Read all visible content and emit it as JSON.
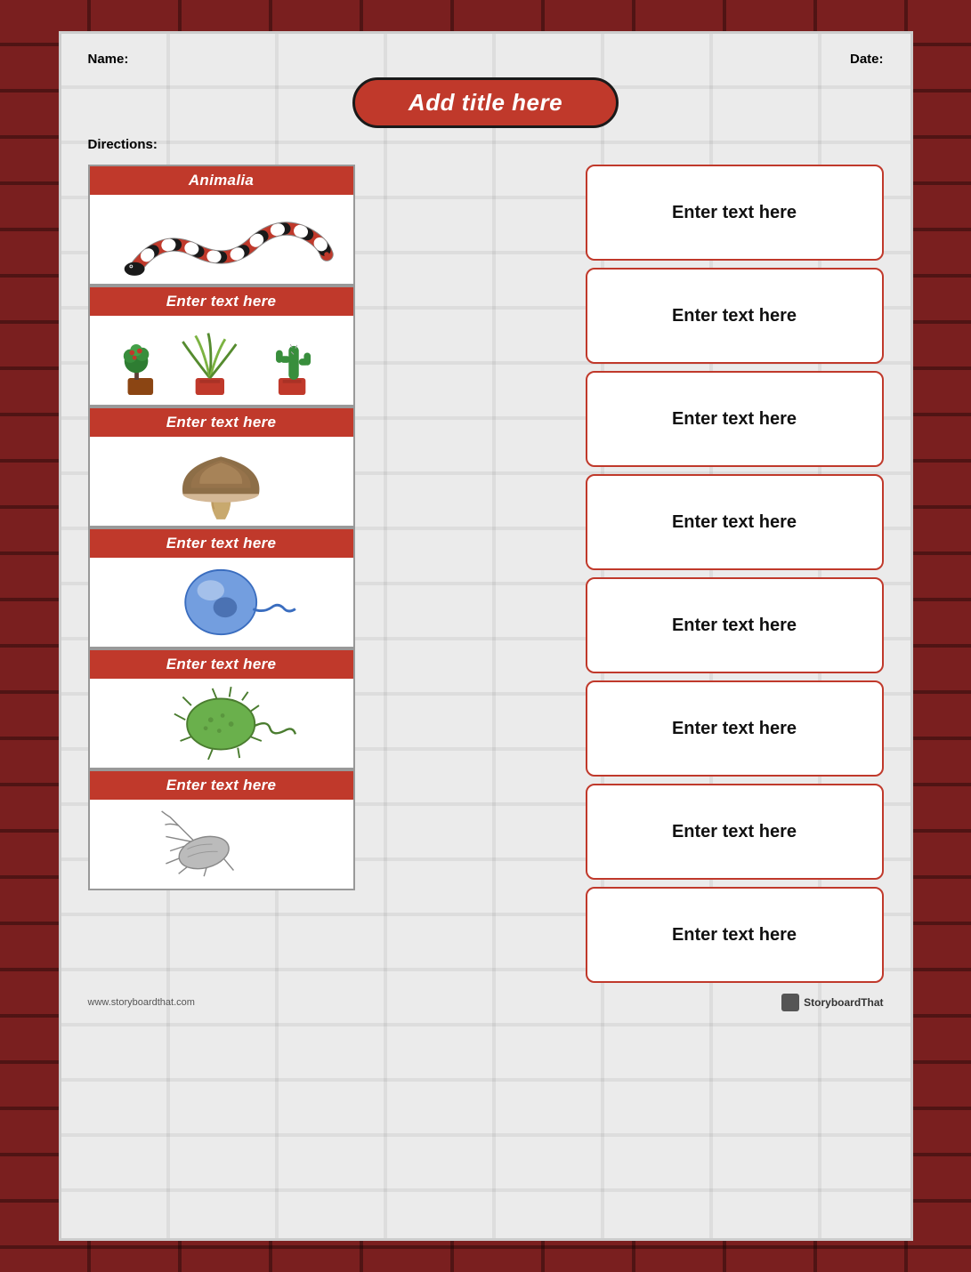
{
  "header": {
    "name_label": "Name:",
    "date_label": "Date:"
  },
  "title": "Add title here",
  "directions_label": "Directions:",
  "left_cards": [
    {
      "header": "Animalia",
      "image_type": "snake",
      "alt": "Coral snake illustration"
    },
    {
      "header": "Enter text here",
      "image_type": "plants",
      "alt": "Potted plants illustration"
    },
    {
      "header": "Enter text here",
      "image_type": "mushroom",
      "alt": "Mushroom illustration"
    },
    {
      "header": "Enter text here",
      "image_type": "cell",
      "alt": "Protist cell illustration"
    },
    {
      "header": "Enter text here",
      "image_type": "bacteria",
      "alt": "Bacteria illustration"
    },
    {
      "header": "Enter text here",
      "image_type": "archaea",
      "alt": "Archaea illustration"
    }
  ],
  "right_boxes": [
    "Enter text here",
    "Enter text here",
    "Enter text here",
    "Enter text here",
    "Enter text here",
    "Enter text here",
    "Enter text here",
    "Enter text here"
  ],
  "footer": {
    "website": "www.storyboardthat.com",
    "brand": "StoryboardThat"
  }
}
